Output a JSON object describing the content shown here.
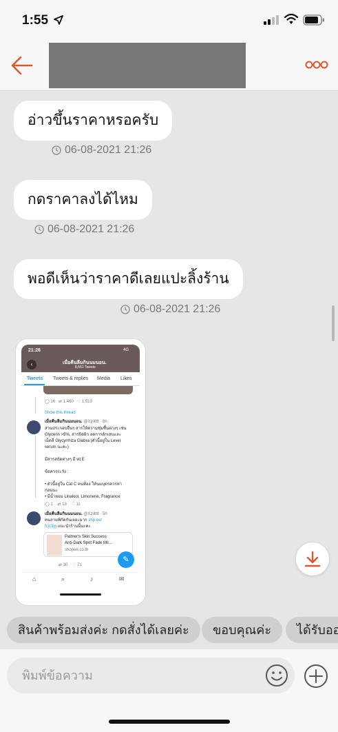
{
  "status_bar": {
    "time": "1:55"
  },
  "header": {
    "name": ""
  },
  "colors": {
    "accent": "#e0552e",
    "bubble": "#ffffff",
    "background": "#e6e6e6"
  },
  "messages": [
    {
      "text": "อ่าวขึ้นราคาหรอครับ",
      "time": "06-08-2021 21:26"
    },
    {
      "text": "กดราคาลงได้ไหม",
      "time": "06-08-2021 21:26"
    },
    {
      "text": "พอดีเห็นว่าราคาดีเลยแปะลิ้งร้าน",
      "time": "06-08-2021 21:26"
    }
  ],
  "image_message": {
    "time": "21:26",
    "signal": "4G",
    "profile_name": "เมื่อคืนลืมกินนมนอน.",
    "tweet_count": "8,661 Tweets",
    "tabs": [
      "Tweets",
      "Tweets & replies",
      "Media",
      "Likes"
    ],
    "stats1": {
      "replies": "16",
      "retweets": "1,460",
      "likes": "1,513"
    },
    "show_thread": "Show this thread",
    "tweet1": {
      "author": "เมื่อคืนลืมกินนมนอน.",
      "handle": "@Xziitttt · 6h",
      "lines": [
        "ส่วนประกอบอื่นๆ สารให้ความชุ่มชื้นต่างๆ เช่น",
        "Glycerin >5%, สารปิดผิว ลดการอักเสบและ",
        "เม็ดสี Glycyrrhiza Glabra (ตัวนี้อยู่ใน Level",
        "serum นะคะ)",
        "",
        "มีสารสกัดต่างๆ มี vit E",
        "",
        "ข้อควรระวัง :",
        "",
        "• ตัวนี้อยู่ใน Cat C คนท้อง ให้นมบุตรควรหา",
        "ก่อนนะ",
        "• มีน้ำหอม Linalool, Limonene, Fragrance"
      ],
      "stats": {
        "replies": "1",
        "retweets": "13",
        "likes": "11"
      }
    },
    "tweet2": {
      "author": "เมื่อคืนลืมกินนมนอน.",
      "handle": "@Xziitttt · 5h",
      "line1": "คนถามพิกัดกันเยอะมาก",
      "link1": "shp.ee/",
      "link2": "fcjc3jg",
      "line2": "แนะนำร้านนี้นะคะ",
      "card_title1": "Palmer's Skin Success",
      "card_title2": "Anti-Dark Spot Fade Mil...",
      "card_domain": "shopee.co.th",
      "stats": {
        "retweets": "30",
        "likes": "71"
      }
    }
  },
  "quick_replies": [
    "สินค้าพร้อมส่งค่ะ กดสั่งได้เลยค่ะ",
    "ขอบคุณค่ะ",
    "ได้รับออ"
  ],
  "composer": {
    "placeholder": "พิมพ์ข้อความ"
  },
  "icons": [
    "location-arrow-icon",
    "signal-icon",
    "wifi-icon",
    "battery-icon",
    "back-arrow-icon",
    "more-dots-icon",
    "clock-icon",
    "download-arrow-icon",
    "emoji-icon",
    "plus-icon"
  ]
}
